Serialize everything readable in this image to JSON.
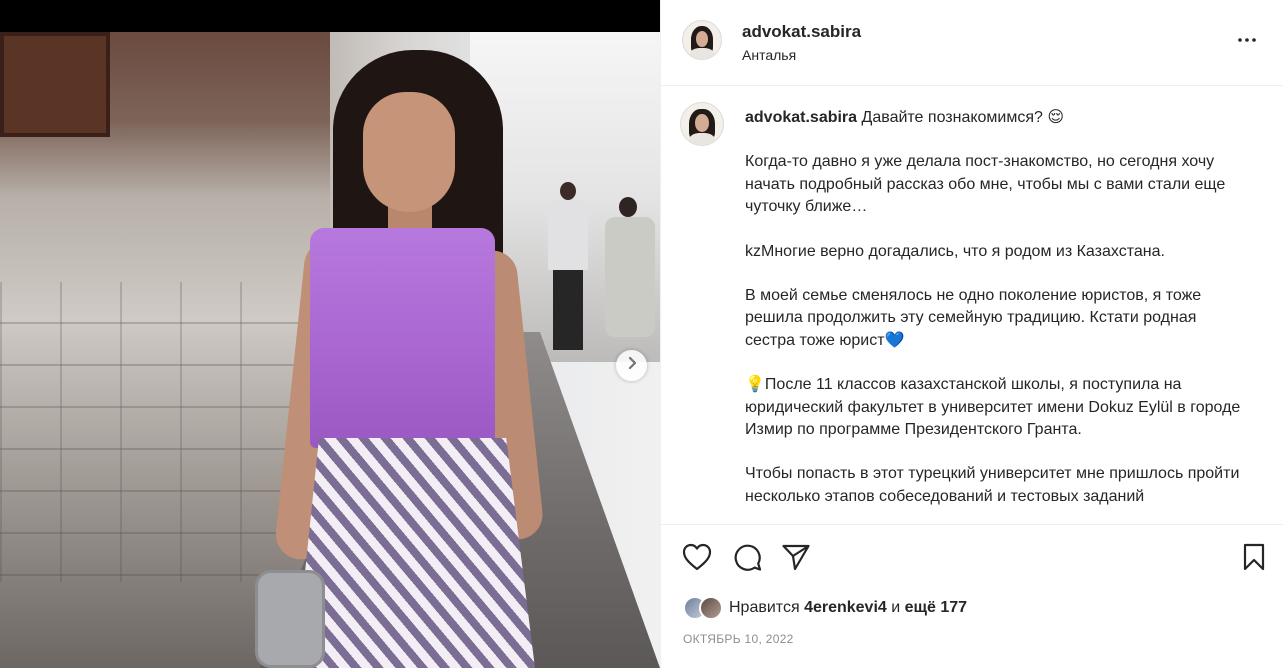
{
  "post": {
    "username": "advokat.sabira",
    "location": "Анталья"
  },
  "caption": {
    "username": "advokat.sabira",
    "headline": "Давайте познакомимся? 😌",
    "paragraphs": [
      "Когда-то давно я уже делала пост-знакомство, но сегодня хочу начать подробный рассказ обо мне, чтобы мы с вами стали еще чуточку ближе…",
      "kzМногие верно догадались, что я родом из Казахстана.",
      "В моей семье сменялось не одно поколение юристов, я тоже решила продолжить эту семейную традицию. Кстати родная сестра тоже юрист💙",
      "💡После 11 классов казахстанской школы, я поступила на юридический факультет в университет имени Dokuz Eylül в городе Измир по программе Президентского Гранта.",
      "Чтобы попасть в этот турецкий университет мне пришлось пройти несколько этапов собеседований и тестовых заданий"
    ]
  },
  "likes": {
    "prefix": "Нравится",
    "user": "4erenkevi4",
    "connector": "и",
    "others": "ещё 177"
  },
  "date": "ОКТЯБРЬ 10, 2022",
  "icons": {
    "more": "more-horizontal-icon",
    "like": "heart-icon",
    "comment": "comment-icon",
    "share": "send-icon",
    "save": "bookmark-icon",
    "next": "chevron-right-icon"
  },
  "colors": {
    "text": "#262626",
    "secondary": "#8e8e8e",
    "divider": "#efefef"
  }
}
